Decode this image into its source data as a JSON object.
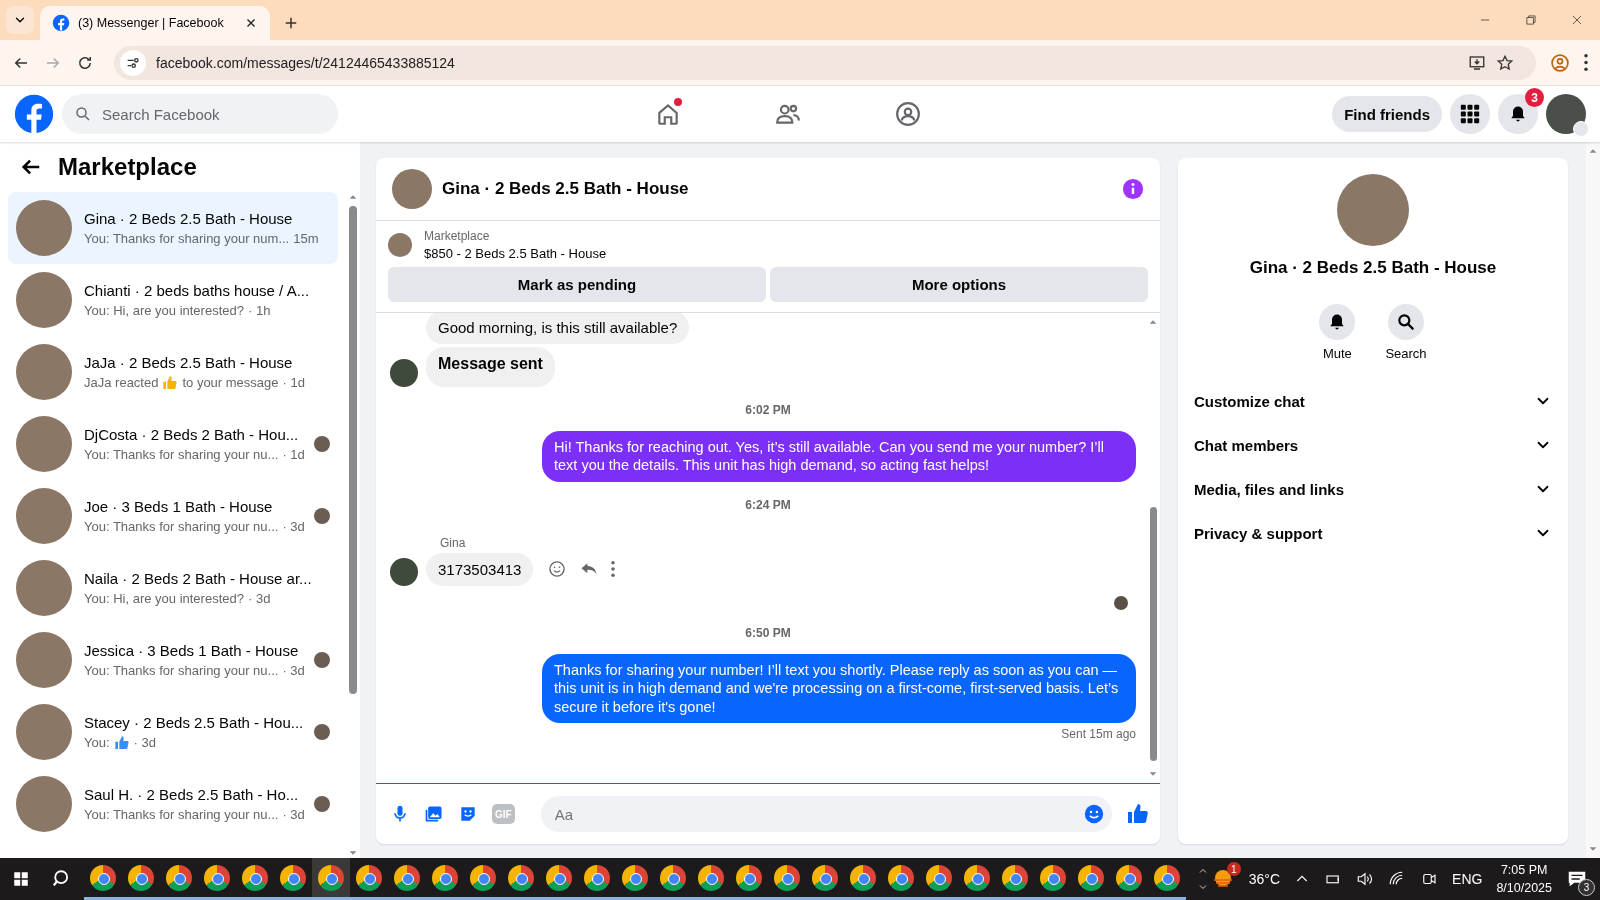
{
  "browser": {
    "tab_title": "(3) Messenger | Facebook",
    "url": "facebook.com/messages/t/24124465433885124"
  },
  "header": {
    "search_placeholder": "Search Facebook",
    "nav": [
      {
        "kind": "home",
        "dot": true
      },
      {
        "kind": "friends",
        "dot": false
      },
      {
        "kind": "groups",
        "dot": false
      }
    ],
    "find_friends": "Find friends",
    "notifications_badge": "3"
  },
  "sidebar": {
    "title": "Marketplace",
    "conversations": [
      {
        "title": "Gina · 2 Beds 2.5 Bath - House",
        "preview": [
          "You: Thanks for sharing your num..."
        ],
        "time": "15m",
        "selected": true,
        "seen_avatar": false
      },
      {
        "title": "Chianti · 2 beds baths house / A...",
        "preview": [
          "You: Hi, are you interested?"
        ],
        "time": "· 1h",
        "selected": false,
        "seen_avatar": false
      },
      {
        "title": "JaJa · 2 Beds 2.5 Bath - House",
        "preview": [
          {
            "kind": "text",
            "text": "JaJa reacted"
          },
          {
            "kind": "emoji"
          },
          {
            "kind": "text",
            "text": "to your message"
          }
        ],
        "time": "· 1d",
        "selected": false,
        "seen_avatar": false
      },
      {
        "title": "DjCosta · 2 Beds 2 Bath - Hou...",
        "preview": [
          "You: Thanks for sharing your nu..."
        ],
        "time": "· 1d",
        "selected": false,
        "seen_avatar": true
      },
      {
        "title": "Joe · 3 Beds 1 Bath - House",
        "preview": [
          "You: Thanks for sharing your nu..."
        ],
        "time": "· 3d",
        "selected": false,
        "seen_avatar": true
      },
      {
        "title": "Naila · 2 Beds 2 Bath - House ar...",
        "preview": [
          "You: Hi, are you interested?"
        ],
        "time": "· 3d",
        "selected": false,
        "seen_avatar": false
      },
      {
        "title": "Jessica · 3 Beds 1 Bath - House",
        "preview": [
          "You: Thanks for sharing your nu..."
        ],
        "time": "· 3d",
        "selected": false,
        "seen_avatar": true
      },
      {
        "title": "Stacey · 2 Beds 2.5 Bath - Hou...",
        "preview": [
          {
            "kind": "text",
            "text": "You:"
          },
          {
            "kind": "like"
          }
        ],
        "time": "· 3d",
        "selected": false,
        "seen_avatar": true
      },
      {
        "title": "Saul H. · 2 Beds 2.5 Bath - Ho...",
        "preview": [
          "You: Thanks for sharing your nu..."
        ],
        "time": "· 3d",
        "selected": false,
        "seen_avatar": true
      }
    ]
  },
  "chat": {
    "title": "Gina · 2 Beds 2.5 Bath - House",
    "listing_source": "Marketplace",
    "listing": "$850 - 2 Beds 2.5 Bath - House",
    "buttons": [
      "Mark as pending",
      "More options"
    ],
    "messages": [
      {
        "kind": "incoming",
        "text": "Good morning, is this still available?",
        "avatar": false,
        "emphasis": false,
        "actions": false
      },
      {
        "kind": "incoming",
        "text": "Message sent",
        "avatar": true,
        "emphasis": true,
        "actions": false
      },
      {
        "kind": "time",
        "text": "6:02 PM"
      },
      {
        "kind": "outgoing",
        "text": "Hi! Thanks for reaching out. Yes, it’s still available. Can you send me your number? I’ll text you the details. This unit has high demand, so acting fast helps!",
        "color": "#7b2ff7"
      },
      {
        "kind": "time",
        "text": "6:24 PM"
      },
      {
        "kind": "sender",
        "text": "Gina"
      },
      {
        "kind": "incoming",
        "text": "3173503413",
        "avatar": true,
        "emphasis": false,
        "actions": true
      },
      {
        "kind": "seen"
      },
      {
        "kind": "time",
        "text": "6:50 PM"
      },
      {
        "kind": "outgoing",
        "text": "Thanks for sharing your number! I’ll text you shortly. Please reply as soon as you can — this unit is in high demand and we're processing on a first-come, first-served basis. Let’s secure it before it's gone!",
        "color": "#0866ff"
      },
      {
        "kind": "status",
        "text": "Sent 15m ago"
      }
    ],
    "composer": {
      "placeholder": "Aa",
      "gif_label": "GIF"
    }
  },
  "details": {
    "title": "Gina · 2 Beds 2.5 Bath - House",
    "actions": [
      {
        "kind": "mute",
        "label": "Mute"
      },
      {
        "kind": "search",
        "label": "Search"
      }
    ],
    "sections": [
      {
        "label": "Customize chat",
        "expanded": false
      },
      {
        "label": "Chat members",
        "expanded": false
      },
      {
        "label": "Media, files and links",
        "expanded": false
      },
      {
        "label": "Privacy & support",
        "expanded": false
      }
    ]
  },
  "taskbar": {
    "apps": [
      {
        "selected": false
      },
      {
        "selected": false
      },
      {
        "selected": false
      },
      {
        "selected": false
      },
      {
        "selected": false
      },
      {
        "selected": false
      },
      {
        "selected": true
      },
      {
        "selected": false
      },
      {
        "selected": false
      },
      {
        "selected": false
      },
      {
        "selected": false
      },
      {
        "selected": false
      },
      {
        "selected": false
      },
      {
        "selected": false
      },
      {
        "selected": false
      },
      {
        "selected": false
      },
      {
        "selected": false
      },
      {
        "selected": false
      },
      {
        "selected": false
      },
      {
        "selected": false
      },
      {
        "selected": false
      },
      {
        "selected": false
      },
      {
        "selected": false
      },
      {
        "selected": false
      },
      {
        "selected": false
      },
      {
        "selected": false
      },
      {
        "selected": false
      },
      {
        "selected": false
      },
      {
        "selected": false
      }
    ],
    "weather_badge": "1",
    "temperature": "36°C",
    "language": "ENG",
    "time": "7:05 PM",
    "date": "8/10/2025",
    "notifications": "3"
  }
}
